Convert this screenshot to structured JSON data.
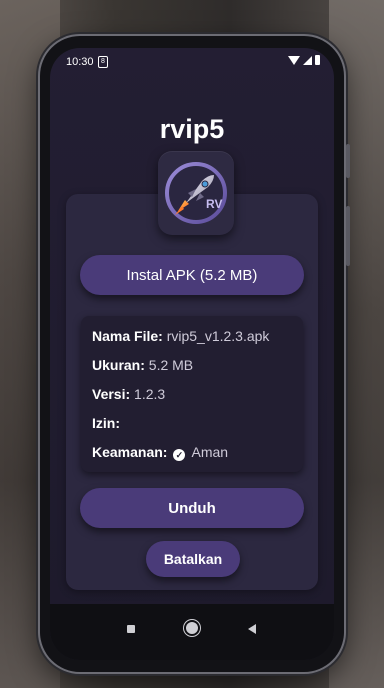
{
  "status_bar": {
    "time": "10:30",
    "notification_glyph": "8"
  },
  "app": {
    "title": "rvip5",
    "icon": {
      "name": "rocket-icon",
      "badge_text": "RV"
    }
  },
  "actions": {
    "install_label": "Instal APK (5.2 MB)",
    "download_label": "Unduh",
    "cancel_label": "Batalkan"
  },
  "info": {
    "file_name": {
      "label": "Nama File:",
      "value": "rvip5_v1.2.3.apk"
    },
    "size": {
      "label": "Ukuran:",
      "value": "5.2 MB"
    },
    "version": {
      "label": "Versi:",
      "value": "1.2.3"
    },
    "permissions": {
      "label": "Izin:",
      "value": ""
    },
    "security": {
      "label": "Keamanan:",
      "value": "Aman",
      "icon": "check-circle-icon"
    }
  },
  "colors": {
    "accent": "#4a3b79",
    "panel": "#2c2840",
    "screen": "#231e33"
  }
}
